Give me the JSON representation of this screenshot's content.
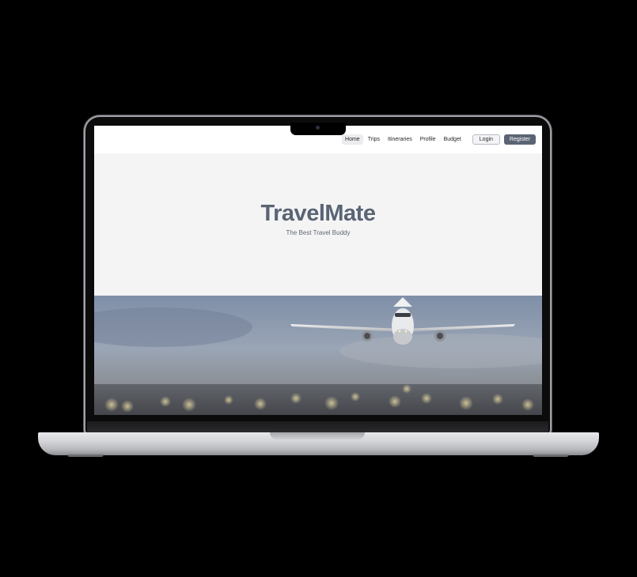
{
  "nav": {
    "links": [
      "Home",
      "Trips",
      "Itineraries",
      "Profile",
      "Budget"
    ],
    "active": "Home",
    "login_label": "Login",
    "register_label": "Register"
  },
  "hero": {
    "title": "TravelMate",
    "subtitle": "The Best Travel Buddy"
  },
  "banner": {
    "image": "airplane-taking-off-photo"
  },
  "colors": {
    "accent": "#5b6473",
    "title": "#5a6474",
    "background": "#f4f4f5"
  }
}
